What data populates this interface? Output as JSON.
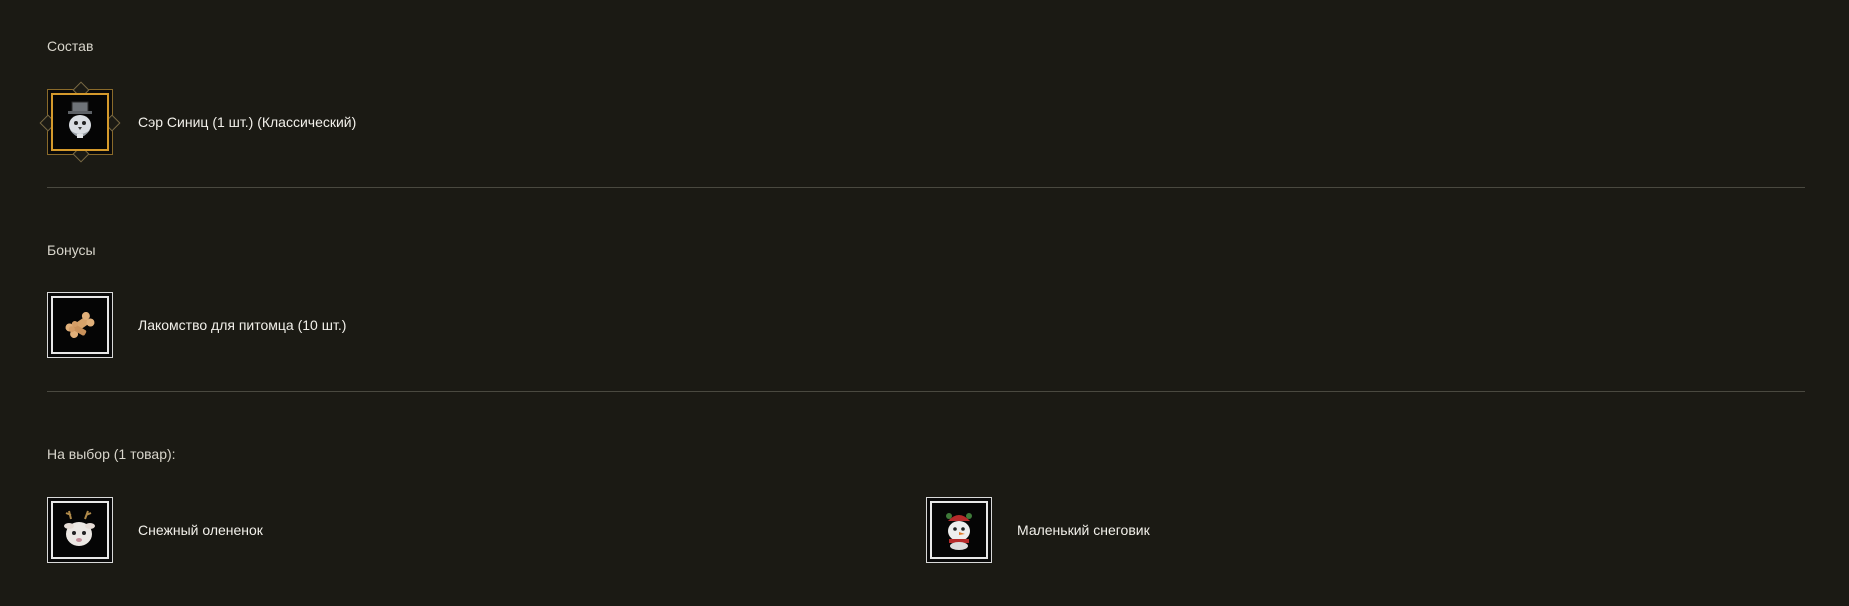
{
  "sections": {
    "composition": {
      "title": "Состав",
      "items": [
        {
          "label": "Сэр Синиц (1 шт.) (Классический)",
          "icon": "top-hat-bird-icon",
          "frame": "classic"
        }
      ]
    },
    "bonuses": {
      "title": "Бонусы",
      "items": [
        {
          "label": "Лакомство для питомца (10 шт.)",
          "icon": "pet-treat-bone-icon"
        }
      ]
    },
    "choice": {
      "title": "На выбор (1 товар):",
      "items": [
        {
          "label": "Снежный олененок",
          "icon": "snow-fawn-icon"
        },
        {
          "label": "Маленький снеговик",
          "icon": "little-snowman-icon"
        }
      ]
    }
  },
  "colors": {
    "background": "#1b1a14",
    "divider": "#4a4940",
    "classic_frame": "#d59a2c",
    "slot_frame": "#e8e8e8"
  }
}
